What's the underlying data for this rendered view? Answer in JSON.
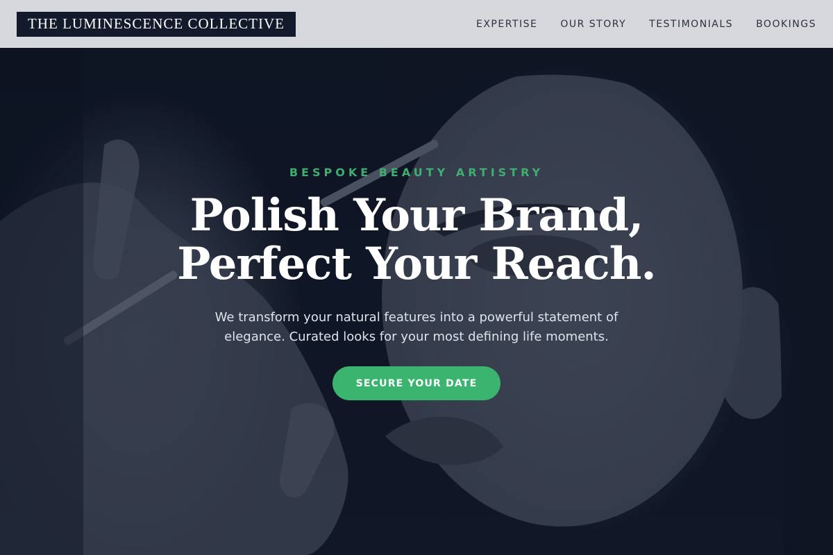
{
  "header": {
    "logo": "THE LUMINESCENCE COLLECTIVE",
    "nav": [
      {
        "label": "EXPERTISE"
      },
      {
        "label": "OUR STORY"
      },
      {
        "label": "TESTIMONIALS"
      },
      {
        "label": "BOOKINGS"
      }
    ]
  },
  "hero": {
    "eyebrow": "BESPOKE BEAUTY ARTISTRY",
    "headline_line1": "Polish Your Brand,",
    "headline_line2": "Perfect Your Reach.",
    "subtitle": "We transform your natural features into a powerful statement of elegance. Curated looks for your most defining life moments.",
    "cta": "SECURE YOUR DATE"
  },
  "colors": {
    "accent": "#3bb46f",
    "navy": "#121a2c",
    "header_bg": "#d6d8dc"
  }
}
